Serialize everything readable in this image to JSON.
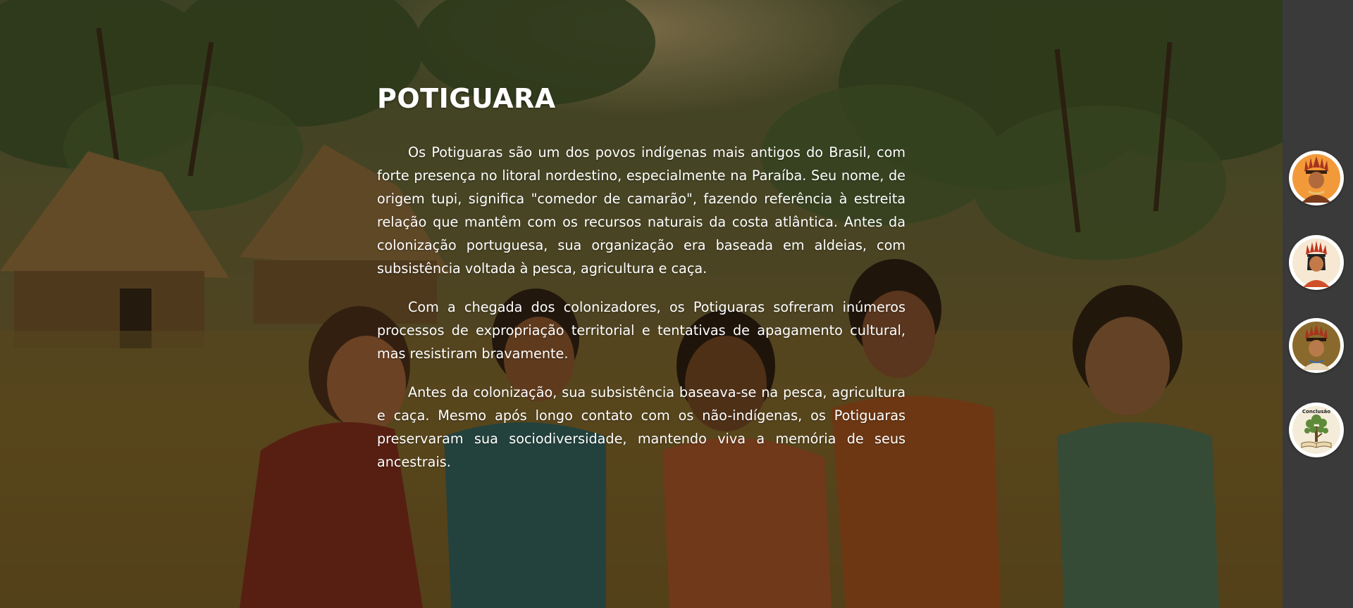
{
  "article": {
    "title": "POTIGUARA",
    "paragraphs": [
      "Os Potiguaras são um dos povos indígenas mais antigos do Brasil, com forte presença no litoral nordestino, especialmente na Paraíba. Seu nome, de origem tupi, significa \"comedor de camarão\", fazendo referência à estreita relação que mantêm com os recursos naturais da costa atlântica. Antes da colonização portuguesa, sua organização era baseada em aldeias, com subsistência voltada à pesca, agricultura e caça.",
      "Com a chegada dos colonizadores, os Potiguaras sofreram inúmeros processos de expropriação territorial e tentativas de apagamento cultural, mas resistiram bravamente.",
      "Antes da colonização, sua subsistência baseava-se na pesca, agricultura e caça. Mesmo após longo contato com os não-indígenas, os Potiguaras preservaram sua sociodiversidade, mantendo viva a memória de seus ancestrais."
    ]
  },
  "sidebar": {
    "items": [
      {
        "icon": "indigenous-portrait-orange-icon",
        "bg": "#f29a3a"
      },
      {
        "icon": "indigenous-portrait-light-icon",
        "bg": "#f6e8d2"
      },
      {
        "icon": "indigenous-portrait-olive-icon",
        "bg": "#8a6a2c"
      },
      {
        "icon": "tree-book-icon",
        "label": "Conclusão",
        "bg": "#f4ecd8"
      }
    ]
  },
  "colors": {
    "sidebar_bg": "#3a3a3a",
    "text": "#ffffff"
  }
}
